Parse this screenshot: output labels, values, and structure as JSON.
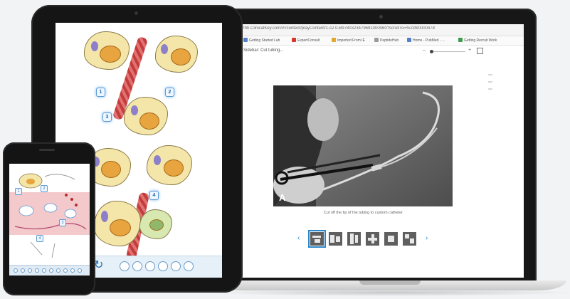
{
  "laptop": {
    "url": "fhh.ClinicalKey.com/#!/content/playContent/1-s2.0-B9780323479691000060?scrollTo=%23hl0000478",
    "bookmarks": [
      {
        "label": "Getting Started Lab",
        "color": "#4f82c8"
      },
      {
        "label": "ExpertConsult",
        "color": "#d9362b"
      },
      {
        "label": "Imported From IE",
        "color": "#e2a82a"
      },
      {
        "label": "PeptideHub",
        "color": "#9a9a9a"
      },
      {
        "label": "Home - PubMed - ...",
        "color": "#4f82c8"
      },
      {
        "label": "Getting Recruit Work",
        "color": "#3e9b4f"
      }
    ],
    "app_title": "Sidebar: Cut tubing...",
    "photo_letter": "A",
    "caption": "Cut off the tip of the tubing to custom catheter.",
    "nav_prev": "‹",
    "nav_next": "›",
    "thumbnails": 6,
    "active_thumbnail_index": 0
  },
  "tablet": {
    "steps": [
      "1",
      "2",
      "3",
      "4"
    ],
    "toolbar_buttons": 6,
    "refresh_icon": "↻"
  },
  "phone": {
    "toolbar_buttons": 10,
    "steps": [
      "1",
      "2",
      "3",
      "4"
    ]
  },
  "colors": {
    "accent": "#2c87c9",
    "device_body": "#151515"
  }
}
